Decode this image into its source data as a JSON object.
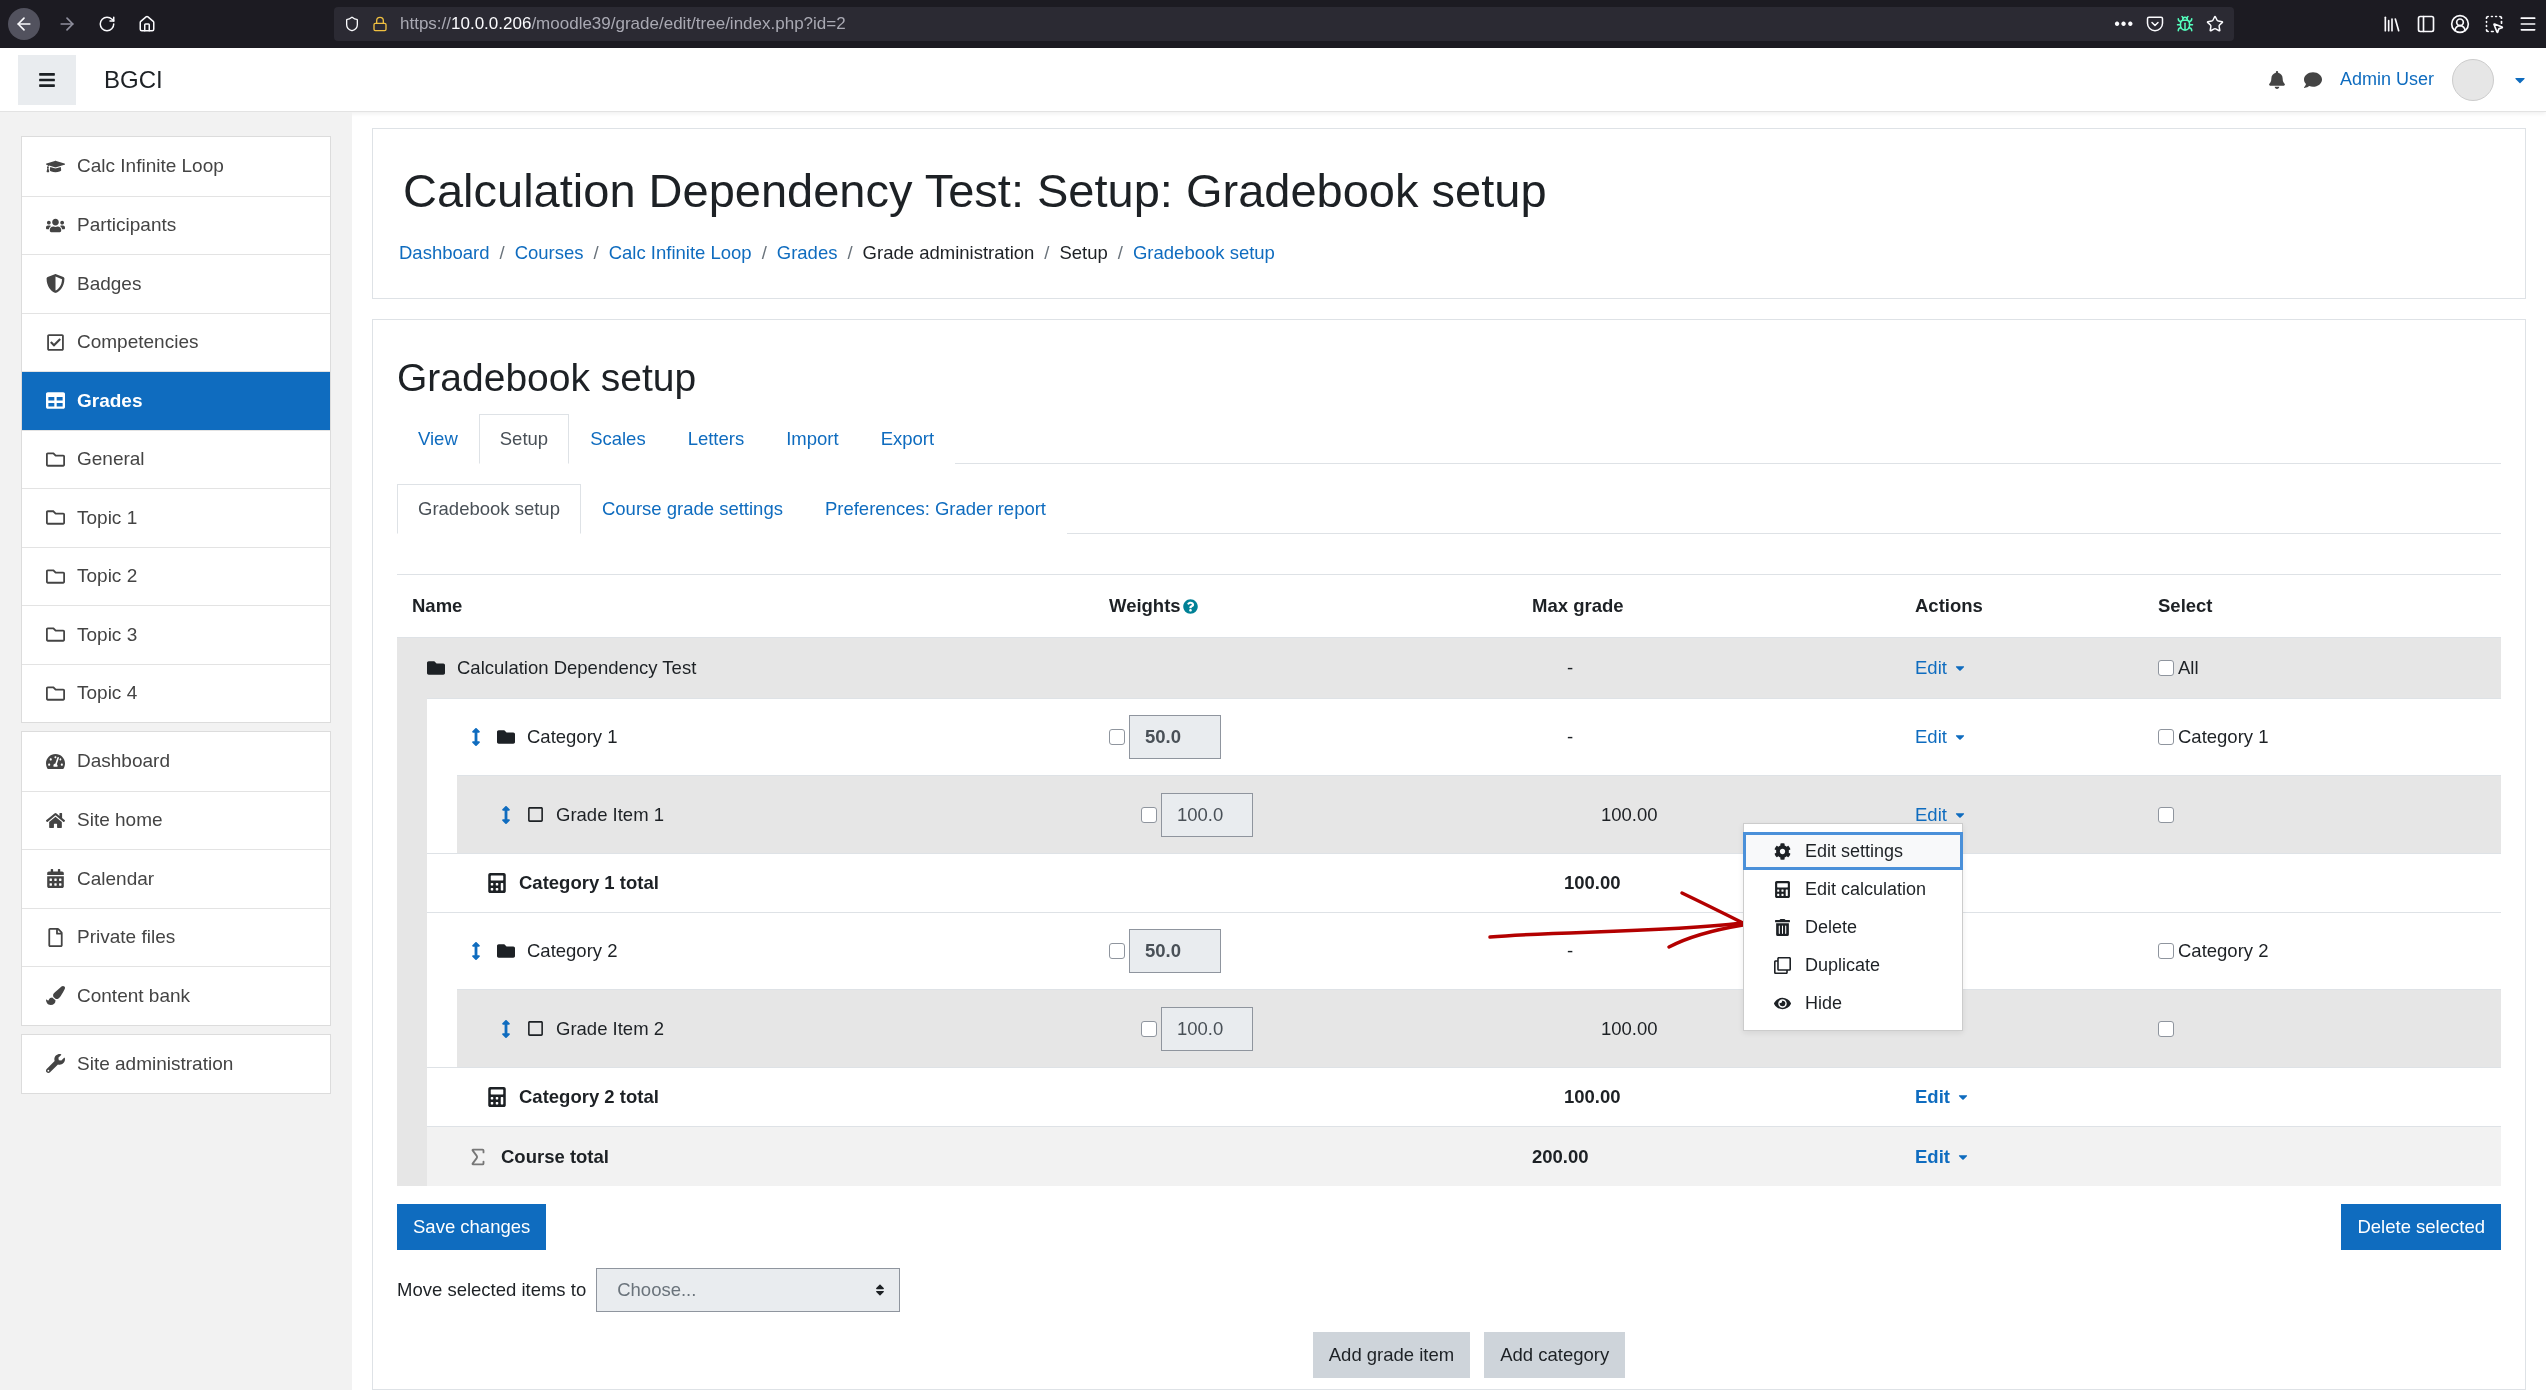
{
  "browser": {
    "url": {
      "scheme": "https://",
      "host": "10.0.0.206",
      "path": "/moodle39/grade/edit/tree/index.php?id=2"
    },
    "more": "•••"
  },
  "navbar": {
    "site_name": "BGCI",
    "user_name": "Admin User"
  },
  "sidebar": {
    "groups": [
      {
        "items": [
          {
            "label": "Calc Infinite Loop",
            "selected": false
          },
          {
            "label": "Participants",
            "selected": false
          },
          {
            "label": "Badges",
            "selected": false
          },
          {
            "label": "Competencies",
            "selected": false
          },
          {
            "label": "Grades",
            "selected": true
          },
          {
            "label": "General",
            "selected": false
          },
          {
            "label": "Topic 1",
            "selected": false
          },
          {
            "label": "Topic 2",
            "selected": false
          },
          {
            "label": "Topic 3",
            "selected": false
          },
          {
            "label": "Topic 4",
            "selected": false
          }
        ]
      },
      {
        "items": [
          {
            "label": "Dashboard",
            "selected": false
          },
          {
            "label": "Site home",
            "selected": false
          },
          {
            "label": "Calendar",
            "selected": false
          },
          {
            "label": "Private files",
            "selected": false
          },
          {
            "label": "Content bank",
            "selected": false
          }
        ]
      },
      {
        "items": [
          {
            "label": "Site administration",
            "selected": false
          }
        ]
      }
    ]
  },
  "header": {
    "separator": "/",
    "title": "Calculation Dependency Test: Setup: Gradebook setup",
    "breadcrumb": [
      {
        "label": "Dashboard",
        "link": true
      },
      {
        "label": "Courses",
        "link": true
      },
      {
        "label": "Calc Infinite Loop",
        "link": true
      },
      {
        "label": "Grades",
        "link": true
      },
      {
        "label": "Grade administration",
        "link": false
      },
      {
        "label": "Setup",
        "link": false
      },
      {
        "label": "Gradebook setup",
        "link": true
      }
    ]
  },
  "page_heading": "Gradebook setup",
  "tabs": [
    {
      "label": "View",
      "selected": false
    },
    {
      "label": "Setup",
      "selected": true
    },
    {
      "label": "Scales",
      "selected": false
    },
    {
      "label": "Letters",
      "selected": false
    },
    {
      "label": "Import",
      "selected": false
    },
    {
      "label": "Export",
      "selected": false
    }
  ],
  "subtabs": [
    {
      "label": "Gradebook setup",
      "selected": true
    },
    {
      "label": "Course grade settings",
      "selected": false
    },
    {
      "label": "Preferences: Grader report",
      "selected": false
    }
  ],
  "table": {
    "columns": [
      "Name",
      "Weights",
      "Max grade",
      "Actions",
      "Select"
    ],
    "rows": [
      {
        "kind": "category",
        "name": "Calculation Dependency Test",
        "max_grade": "-",
        "action": "Edit",
        "select_label": "All",
        "select_checked": false,
        "children": [
          {
            "kind": "category",
            "name": "Category 1",
            "weight": "50.0",
            "weight_checked": false,
            "max_grade": "-",
            "action": "Edit",
            "select_label": "Category 1",
            "select_checked": false,
            "children": [
              {
                "kind": "item",
                "name": "Grade Item 1",
                "weight": "100.0",
                "weight_checked": false,
                "max_grade": "100.00",
                "action": "Edit",
                "select_checked": false
              },
              {
                "kind": "total",
                "name": "Category 1 total",
                "max_grade": "100.00"
              }
            ]
          },
          {
            "kind": "category",
            "name": "Category 2",
            "weight": "50.0",
            "weight_checked": false,
            "max_grade": "-",
            "select_label": "Category 2",
            "select_checked": false,
            "children": [
              {
                "kind": "item",
                "name": "Grade Item 2",
                "weight": "100.0",
                "weight_checked": false,
                "max_grade": "100.00",
                "select_checked": false
              },
              {
                "kind": "total",
                "name": "Category 2 total",
                "max_grade": "100.00",
                "action": "Edit"
              }
            ]
          },
          {
            "kind": "course_total",
            "name": "Course total",
            "max_grade": "200.00",
            "action": "Edit"
          }
        ]
      }
    ]
  },
  "action_menu": {
    "items": [
      {
        "label": "Edit settings",
        "focused": true
      },
      {
        "label": "Edit calculation",
        "focused": false
      },
      {
        "label": "Delete",
        "focused": false
      },
      {
        "label": "Duplicate",
        "focused": false
      },
      {
        "label": "Hide",
        "focused": false
      }
    ]
  },
  "buttons": {
    "save": "Save changes",
    "delete_selected": "Delete selected",
    "add_grade_item": "Add grade item",
    "add_category": "Add category"
  },
  "move": {
    "label": "Move selected items to",
    "placeholder": "Choose..."
  }
}
